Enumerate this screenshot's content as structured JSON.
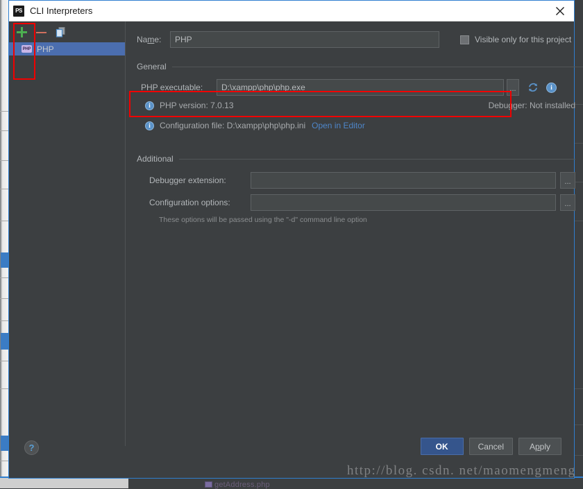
{
  "window": {
    "title": "CLI Interpreters",
    "app_icon": "phpstorm-icon",
    "app_icon_text": "PS",
    "close_label": "✕"
  },
  "left_panel": {
    "toolbar": [
      {
        "name": "add-button",
        "label": "+"
      },
      {
        "name": "remove-button",
        "label": "−"
      },
      {
        "name": "copy-button",
        "label": ""
      }
    ],
    "items": [
      {
        "label": "PHP",
        "badge": "PHP",
        "selected": true
      }
    ]
  },
  "form": {
    "name_label": "Na",
    "name_label_mnemonic": "m",
    "name_label_tail": "e:",
    "name_value": "PHP",
    "name_placeholder": "",
    "visible_only_label": "Visible only for this project",
    "visible_only_checked": false
  },
  "general": {
    "section_title": "General",
    "php_executable_label": "PHP executable:",
    "php_executable_value": "D:\\xampp\\php\\php.exe",
    "php_executable_placeholder": "",
    "browse_label": "...",
    "refresh_icon": "refresh-icon",
    "info_icon": "info-icon",
    "php_version_text": "PHP version: 7.0.13",
    "debugger_text": "Debugger: Not installed",
    "config_file_text": "Configuration file: D:\\xampp\\php\\php.ini",
    "open_in_editor_label": "Open in Editor"
  },
  "additional": {
    "section_title": "Additional",
    "debugger_extension_label": "Debugger extension:",
    "debugger_extension_value": "",
    "debugger_extension_browse": "...",
    "configuration_options_label": "Configuration options:",
    "configuration_options_value": "",
    "configuration_options_browse": "...",
    "hint": "These options will be passed using the \"-d\" command line option"
  },
  "footer": {
    "help_label": "?",
    "ok_label": "OK",
    "cancel_label": "Cancel",
    "apply_label_head": "A",
    "apply_label_mnemonic": "p",
    "apply_label_tail": "ply"
  },
  "watermark": "http://blog. csdn. net/maomengmeng",
  "background": {
    "editor_tab_file": "getAddress.php"
  },
  "colors": {
    "accent_blue": "#2f7fd0",
    "selection_blue": "#4b6eaf",
    "annotation_red": "#f10000",
    "link_blue": "#4e86c9",
    "panel_bg": "#3c3f41",
    "field_bg": "#45494a",
    "add_green": "#4caf50",
    "remove_red": "#d0705e"
  }
}
